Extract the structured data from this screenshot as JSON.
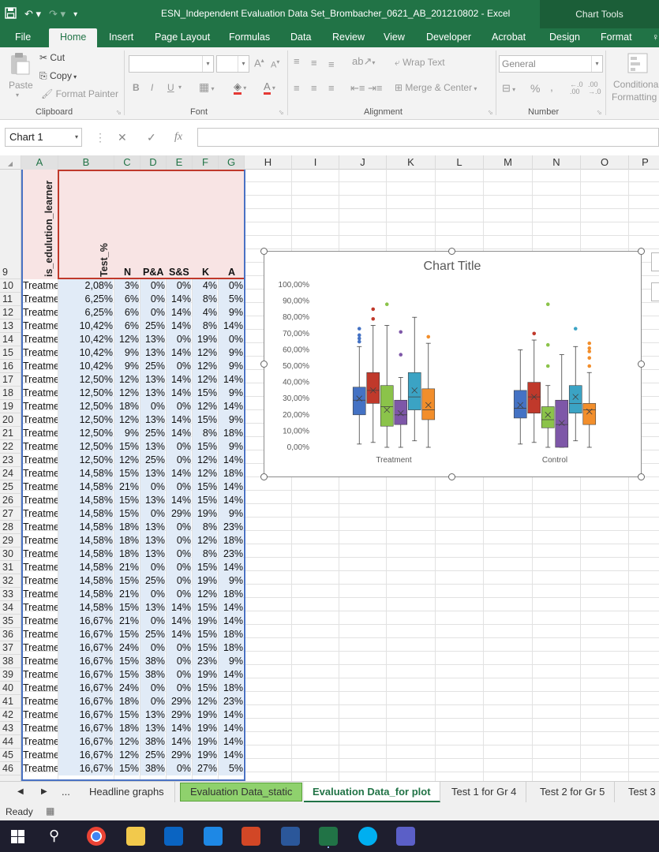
{
  "window": {
    "title": "ESN_Independent Evaluation Data Set_Brombacher_0621_AB_201210802 - Excel",
    "chart_tools_label": "Chart Tools"
  },
  "menu": [
    "File",
    "Home",
    "Insert",
    "Page Layout",
    "Formulas",
    "Data",
    "Review",
    "View",
    "Developer",
    "Acrobat",
    "Design",
    "Format"
  ],
  "ribbon": {
    "clipboard": {
      "paste": "Paste",
      "cut": "Cut",
      "copy": "Copy",
      "format_painter": "Format Painter",
      "label": "Clipboard"
    },
    "font": {
      "label": "Font",
      "bold": "B",
      "italic": "I",
      "underline": "U"
    },
    "alignment": {
      "wrap_text": "Wrap Text",
      "merge_center": "Merge & Center",
      "label": "Alignment"
    },
    "number": {
      "format": "General",
      "percent": "%",
      "comma": ",",
      "label": "Number"
    },
    "styles": {
      "conditional": "Conditional",
      "formatting": "Formatting"
    }
  },
  "formula_bar": {
    "name_box": "Chart 1",
    "fx": "fx",
    "cancel": "✕",
    "enter": "✓"
  },
  "columns": [
    "A",
    "B",
    "C",
    "D",
    "E",
    "F",
    "G",
    "H",
    "I",
    "J",
    "K",
    "L",
    "M",
    "N",
    "O",
    "P"
  ],
  "header_row": {
    "row_number": "9",
    "a": "is_edulution_learner",
    "b": "Test_%",
    "c": "N",
    "d": "P&A",
    "e": "S&S",
    "f": "K",
    "g": "A"
  },
  "rows": [
    {
      "n": "10",
      "a": "Treatme",
      "b": "2,08%",
      "c": "3%",
      "d": "0%",
      "e": "0%",
      "f": "4%",
      "g": "0%"
    },
    {
      "n": "11",
      "a": "Treatme",
      "b": "6,25%",
      "c": "6%",
      "d": "0%",
      "e": "14%",
      "f": "8%",
      "g": "5%"
    },
    {
      "n": "12",
      "a": "Treatme",
      "b": "6,25%",
      "c": "6%",
      "d": "0%",
      "e": "14%",
      "f": "4%",
      "g": "9%"
    },
    {
      "n": "13",
      "a": "Treatme",
      "b": "10,42%",
      "c": "6%",
      "d": "25%",
      "e": "14%",
      "f": "8%",
      "g": "14%"
    },
    {
      "n": "14",
      "a": "Treatme",
      "b": "10,42%",
      "c": "12%",
      "d": "13%",
      "e": "0%",
      "f": "19%",
      "g": "0%"
    },
    {
      "n": "15",
      "a": "Treatme",
      "b": "10,42%",
      "c": "9%",
      "d": "13%",
      "e": "14%",
      "f": "12%",
      "g": "9%"
    },
    {
      "n": "16",
      "a": "Treatme",
      "b": "10,42%",
      "c": "9%",
      "d": "25%",
      "e": "0%",
      "f": "12%",
      "g": "9%"
    },
    {
      "n": "17",
      "a": "Treatme",
      "b": "12,50%",
      "c": "12%",
      "d": "13%",
      "e": "14%",
      "f": "12%",
      "g": "14%"
    },
    {
      "n": "18",
      "a": "Treatme",
      "b": "12,50%",
      "c": "12%",
      "d": "13%",
      "e": "14%",
      "f": "15%",
      "g": "9%"
    },
    {
      "n": "19",
      "a": "Treatme",
      "b": "12,50%",
      "c": "18%",
      "d": "0%",
      "e": "0%",
      "f": "12%",
      "g": "14%"
    },
    {
      "n": "20",
      "a": "Treatme",
      "b": "12,50%",
      "c": "12%",
      "d": "13%",
      "e": "14%",
      "f": "15%",
      "g": "9%"
    },
    {
      "n": "21",
      "a": "Treatme",
      "b": "12,50%",
      "c": "9%",
      "d": "25%",
      "e": "14%",
      "f": "8%",
      "g": "18%"
    },
    {
      "n": "22",
      "a": "Treatme",
      "b": "12,50%",
      "c": "15%",
      "d": "13%",
      "e": "0%",
      "f": "15%",
      "g": "9%"
    },
    {
      "n": "23",
      "a": "Treatme",
      "b": "12,50%",
      "c": "12%",
      "d": "25%",
      "e": "0%",
      "f": "12%",
      "g": "14%"
    },
    {
      "n": "24",
      "a": "Treatme",
      "b": "14,58%",
      "c": "15%",
      "d": "13%",
      "e": "14%",
      "f": "12%",
      "g": "18%"
    },
    {
      "n": "25",
      "a": "Treatme",
      "b": "14,58%",
      "c": "21%",
      "d": "0%",
      "e": "0%",
      "f": "15%",
      "g": "14%"
    },
    {
      "n": "26",
      "a": "Treatme",
      "b": "14,58%",
      "c": "15%",
      "d": "13%",
      "e": "14%",
      "f": "15%",
      "g": "14%"
    },
    {
      "n": "27",
      "a": "Treatme",
      "b": "14,58%",
      "c": "15%",
      "d": "0%",
      "e": "29%",
      "f": "19%",
      "g": "9%"
    },
    {
      "n": "28",
      "a": "Treatme",
      "b": "14,58%",
      "c": "18%",
      "d": "13%",
      "e": "0%",
      "f": "8%",
      "g": "23%"
    },
    {
      "n": "29",
      "a": "Treatme",
      "b": "14,58%",
      "c": "18%",
      "d": "13%",
      "e": "0%",
      "f": "12%",
      "g": "18%"
    },
    {
      "n": "30",
      "a": "Treatme",
      "b": "14,58%",
      "c": "18%",
      "d": "13%",
      "e": "0%",
      "f": "8%",
      "g": "23%"
    },
    {
      "n": "31",
      "a": "Treatme",
      "b": "14,58%",
      "c": "21%",
      "d": "0%",
      "e": "0%",
      "f": "15%",
      "g": "14%"
    },
    {
      "n": "32",
      "a": "Treatme",
      "b": "14,58%",
      "c": "15%",
      "d": "25%",
      "e": "0%",
      "f": "19%",
      "g": "9%"
    },
    {
      "n": "33",
      "a": "Treatme",
      "b": "14,58%",
      "c": "21%",
      "d": "0%",
      "e": "0%",
      "f": "12%",
      "g": "18%"
    },
    {
      "n": "34",
      "a": "Treatme",
      "b": "14,58%",
      "c": "15%",
      "d": "13%",
      "e": "14%",
      "f": "15%",
      "g": "14%"
    },
    {
      "n": "35",
      "a": "Treatme",
      "b": "16,67%",
      "c": "21%",
      "d": "0%",
      "e": "14%",
      "f": "19%",
      "g": "14%"
    },
    {
      "n": "36",
      "a": "Treatme",
      "b": "16,67%",
      "c": "15%",
      "d": "25%",
      "e": "14%",
      "f": "15%",
      "g": "18%"
    },
    {
      "n": "37",
      "a": "Treatme",
      "b": "16,67%",
      "c": "24%",
      "d": "0%",
      "e": "0%",
      "f": "15%",
      "g": "18%"
    },
    {
      "n": "38",
      "a": "Treatme",
      "b": "16,67%",
      "c": "15%",
      "d": "38%",
      "e": "0%",
      "f": "23%",
      "g": "9%"
    },
    {
      "n": "39",
      "a": "Treatme",
      "b": "16,67%",
      "c": "15%",
      "d": "38%",
      "e": "0%",
      "f": "19%",
      "g": "14%"
    },
    {
      "n": "40",
      "a": "Treatme",
      "b": "16,67%",
      "c": "24%",
      "d": "0%",
      "e": "0%",
      "f": "15%",
      "g": "18%"
    },
    {
      "n": "41",
      "a": "Treatme",
      "b": "16,67%",
      "c": "18%",
      "d": "0%",
      "e": "29%",
      "f": "12%",
      "g": "23%"
    },
    {
      "n": "42",
      "a": "Treatme",
      "b": "16,67%",
      "c": "15%",
      "d": "13%",
      "e": "29%",
      "f": "19%",
      "g": "14%"
    },
    {
      "n": "43",
      "a": "Treatme",
      "b": "16,67%",
      "c": "18%",
      "d": "13%",
      "e": "14%",
      "f": "19%",
      "g": "14%"
    },
    {
      "n": "44",
      "a": "Treatme",
      "b": "16,67%",
      "c": "12%",
      "d": "38%",
      "e": "14%",
      "f": "19%",
      "g": "14%"
    },
    {
      "n": "45",
      "a": "Treatme",
      "b": "16,67%",
      "c": "12%",
      "d": "25%",
      "e": "29%",
      "f": "19%",
      "g": "14%"
    },
    {
      "n": "46",
      "a": "Treatme",
      "b": "16,67%",
      "c": "15%",
      "d": "38%",
      "e": "0%",
      "f": "27%",
      "g": "5%"
    }
  ],
  "chart_data": {
    "type": "box",
    "title": "Chart Title",
    "categories": [
      "Treatment",
      "Control"
    ],
    "ylim": [
      0,
      100
    ],
    "yticks": [
      "0,00%",
      "10,00%",
      "20,00%",
      "30,00%",
      "40,00%",
      "50,00%",
      "60,00%",
      "70,00%",
      "80,00%",
      "90,00%",
      "100,00%"
    ],
    "grid": false,
    "legend": "none",
    "series": [
      {
        "color": "#4472c4",
        "boxes": [
          {
            "min": 2,
            "q1": 20,
            "median": 29,
            "q3": 37,
            "max": 62,
            "mean": 30,
            "outliers": [
              65,
              67,
              69,
              73
            ]
          },
          {
            "min": 2,
            "q1": 18,
            "median": 24,
            "q3": 35,
            "max": 60,
            "mean": 26,
            "outliers": []
          }
        ]
      },
      {
        "color": "#c0392b",
        "boxes": [
          {
            "min": 3,
            "q1": 27,
            "median": 35,
            "q3": 46,
            "max": 75,
            "mean": 35,
            "outliers": [
              79,
              85
            ]
          },
          {
            "min": 3,
            "q1": 21,
            "median": 31,
            "q3": 40,
            "max": 66,
            "mean": 31,
            "outliers": [
              70
            ]
          }
        ]
      },
      {
        "color": "#8bc34a",
        "boxes": [
          {
            "min": 0,
            "q1": 13,
            "median": 25,
            "q3": 38,
            "max": 75,
            "mean": 23,
            "outliers": [
              88
            ]
          },
          {
            "min": 0,
            "q1": 12,
            "median": 17,
            "q3": 25,
            "max": 38,
            "mean": 20,
            "outliers": [
              50,
              63,
              88
            ]
          }
        ]
      },
      {
        "color": "#7e57a8",
        "boxes": [
          {
            "min": 0,
            "q1": 14,
            "median": 20,
            "q3": 29,
            "max": 43,
            "mean": 21,
            "outliers": [
              57,
              71
            ]
          },
          {
            "min": 0,
            "q1": 0,
            "median": 14,
            "q3": 29,
            "max": 57,
            "mean": 15,
            "outliers": []
          }
        ]
      },
      {
        "color": "#3ba3c4",
        "boxes": [
          {
            "min": 4,
            "q1": 23,
            "median": 31,
            "q3": 46,
            "max": 80,
            "mean": 35,
            "outliers": []
          },
          {
            "min": 4,
            "q1": 21,
            "median": 27,
            "q3": 38,
            "max": 62,
            "mean": 31,
            "outliers": [
              73
            ]
          }
        ]
      },
      {
        "color": "#f28e2b",
        "boxes": [
          {
            "min": 0,
            "q1": 17,
            "median": 23,
            "q3": 36,
            "max": 64,
            "mean": 26,
            "outliers": [
              68
            ]
          },
          {
            "min": 0,
            "q1": 14,
            "median": 23,
            "q3": 27,
            "max": 46,
            "mean": 22,
            "outliers": [
              50,
              55,
              59,
              61,
              64
            ]
          }
        ]
      }
    ]
  },
  "sheet_tabs": [
    "...",
    "Headline graphs",
    "Evaluation Data_static",
    "Evaluation Data_for plot",
    "Test 1 for Gr 4",
    "Test 2 for Gr 5",
    "Test 3"
  ],
  "status": {
    "ready": "Ready"
  },
  "colors": {
    "excel_green": "#217346",
    "header_pink": "#f8e4e4",
    "cell_blue": "#e1ebf7"
  }
}
